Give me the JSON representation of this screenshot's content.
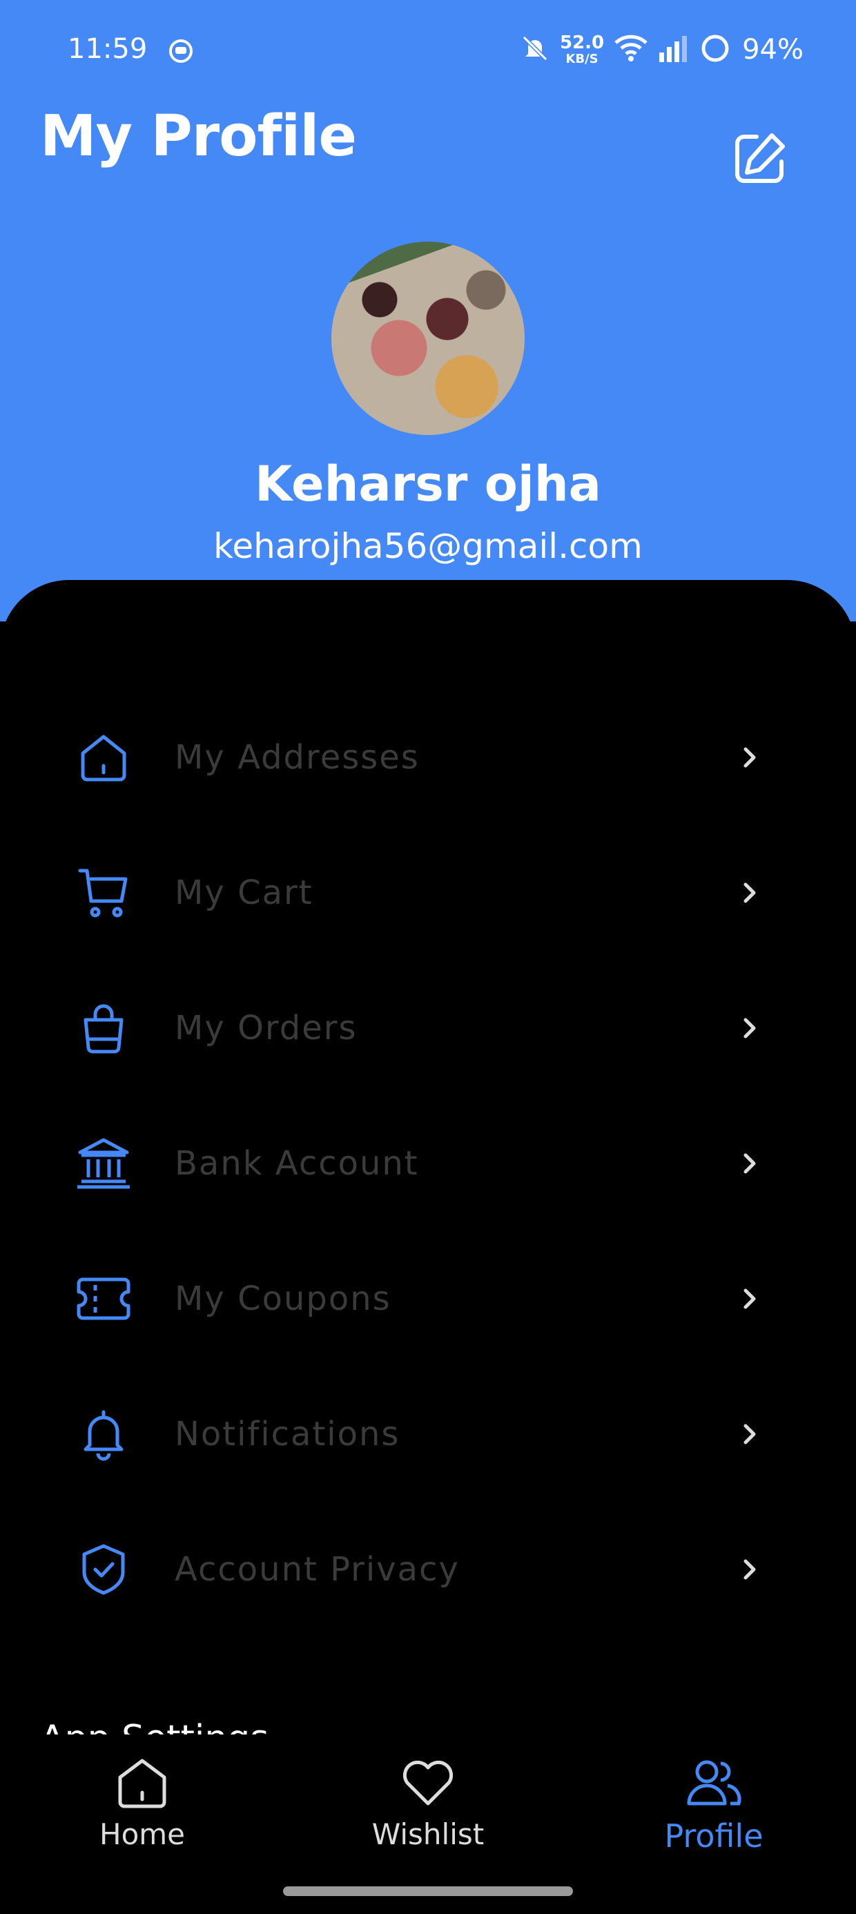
{
  "status_bar": {
    "time": "11:59",
    "net_speed": "52.0",
    "net_unit": "KB/S",
    "battery": "94%"
  },
  "header": {
    "title": "My Profile",
    "user_name": "Keharsr ojha",
    "user_email": "keharojha56@gmail.com"
  },
  "menu": {
    "items": [
      {
        "label": "My Addresses",
        "icon": "home-icon"
      },
      {
        "label": "My Cart",
        "icon": "cart-icon"
      },
      {
        "label": "My Orders",
        "icon": "bag-icon"
      },
      {
        "label": "Bank Account",
        "icon": "bank-icon"
      },
      {
        "label": "My Coupons",
        "icon": "coupon-icon"
      },
      {
        "label": "Notifications",
        "icon": "bell-icon"
      },
      {
        "label": "Account Privacy",
        "icon": "shield-check-icon"
      }
    ],
    "section_title": "App Settings"
  },
  "bottom_nav": {
    "items": [
      {
        "label": "Home",
        "icon": "home-icon"
      },
      {
        "label": "Wishlist",
        "icon": "heart-icon"
      },
      {
        "label": "Profile",
        "icon": "users-icon",
        "active": true
      }
    ]
  },
  "colors": {
    "accent": "#4589f6",
    "background": "#000000",
    "menu_text": "#3b3b3b"
  }
}
